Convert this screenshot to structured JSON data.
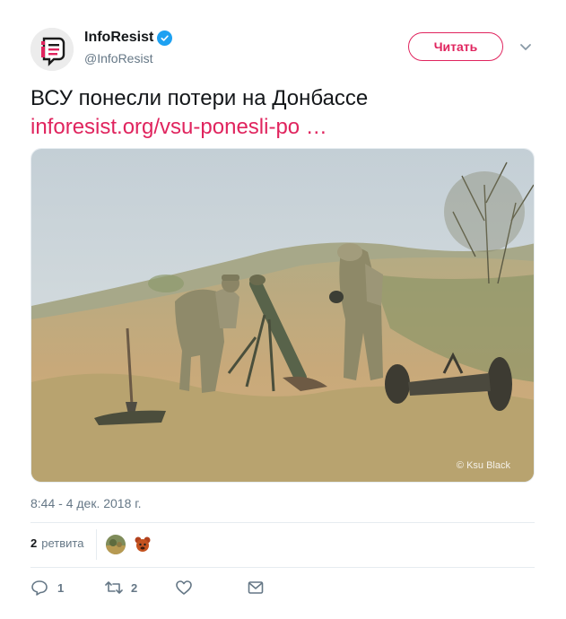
{
  "tweet": {
    "author_name": "InfoResist",
    "author_handle": "@InfoResist",
    "follow_label": "Читать",
    "text": "ВСУ понесли потери на Донбассе",
    "link_text": "inforesist.org/vsu-ponesli-po …",
    "photo_credit": "© Ksu Black",
    "timestamp": "8:44 - 4 дек. 2018 г.",
    "retweets_count": "2",
    "retweets_label": "ретвита"
  },
  "actions": {
    "reply_count": "1",
    "retweet_count": "2"
  },
  "icons": [
    "verified-icon",
    "chevron-down-icon",
    "reply-icon",
    "retweet-icon",
    "like-icon",
    "message-icon"
  ],
  "colors": {
    "accent": "#e0245e",
    "verified": "#1da1f2",
    "secondary_text": "#657786"
  }
}
